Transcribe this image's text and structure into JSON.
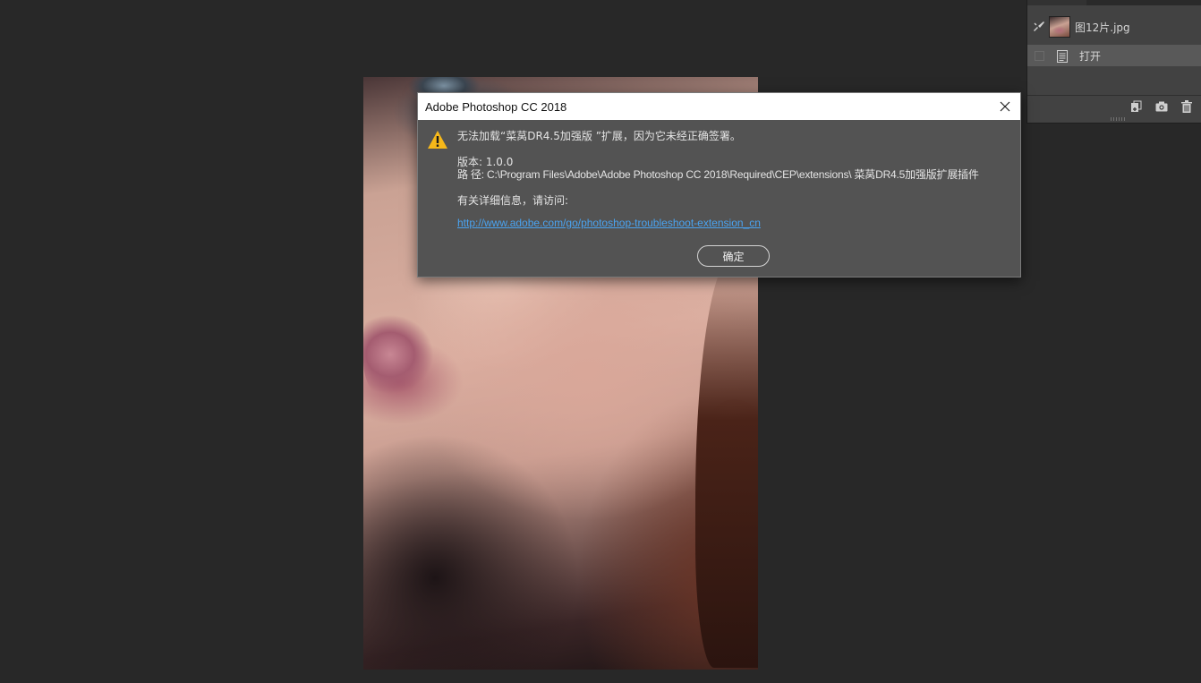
{
  "dialog": {
    "title": "Adobe Photoshop CC 2018",
    "message": "无法加载“菜莴DR4.5加强版 ”扩展，因为它未经正确签署。",
    "version_line": "版本: 1.0.0",
    "path_line": "路 径: C:\\Program Files\\Adobe\\Adobe Photoshop CC 2018\\Required\\CEP\\extensions\\ 菜莴DR4.5加强版扩展插件",
    "info_line": "有关详细信息，请访问:",
    "link": "http://www.adobe.com/go/photoshop-troubleshoot-extension_cn",
    "ok_label": "确定",
    "close_icon": "close-icon",
    "warning_icon": "warning-icon",
    "warning_color": "#f6b81a",
    "link_color": "#4aa3f0"
  },
  "history_panel": {
    "snapshot_label": "图12片.jpg",
    "step_label": "打开",
    "icons": [
      "new-document-from-state-icon",
      "camera-icon",
      "trash-icon"
    ]
  }
}
